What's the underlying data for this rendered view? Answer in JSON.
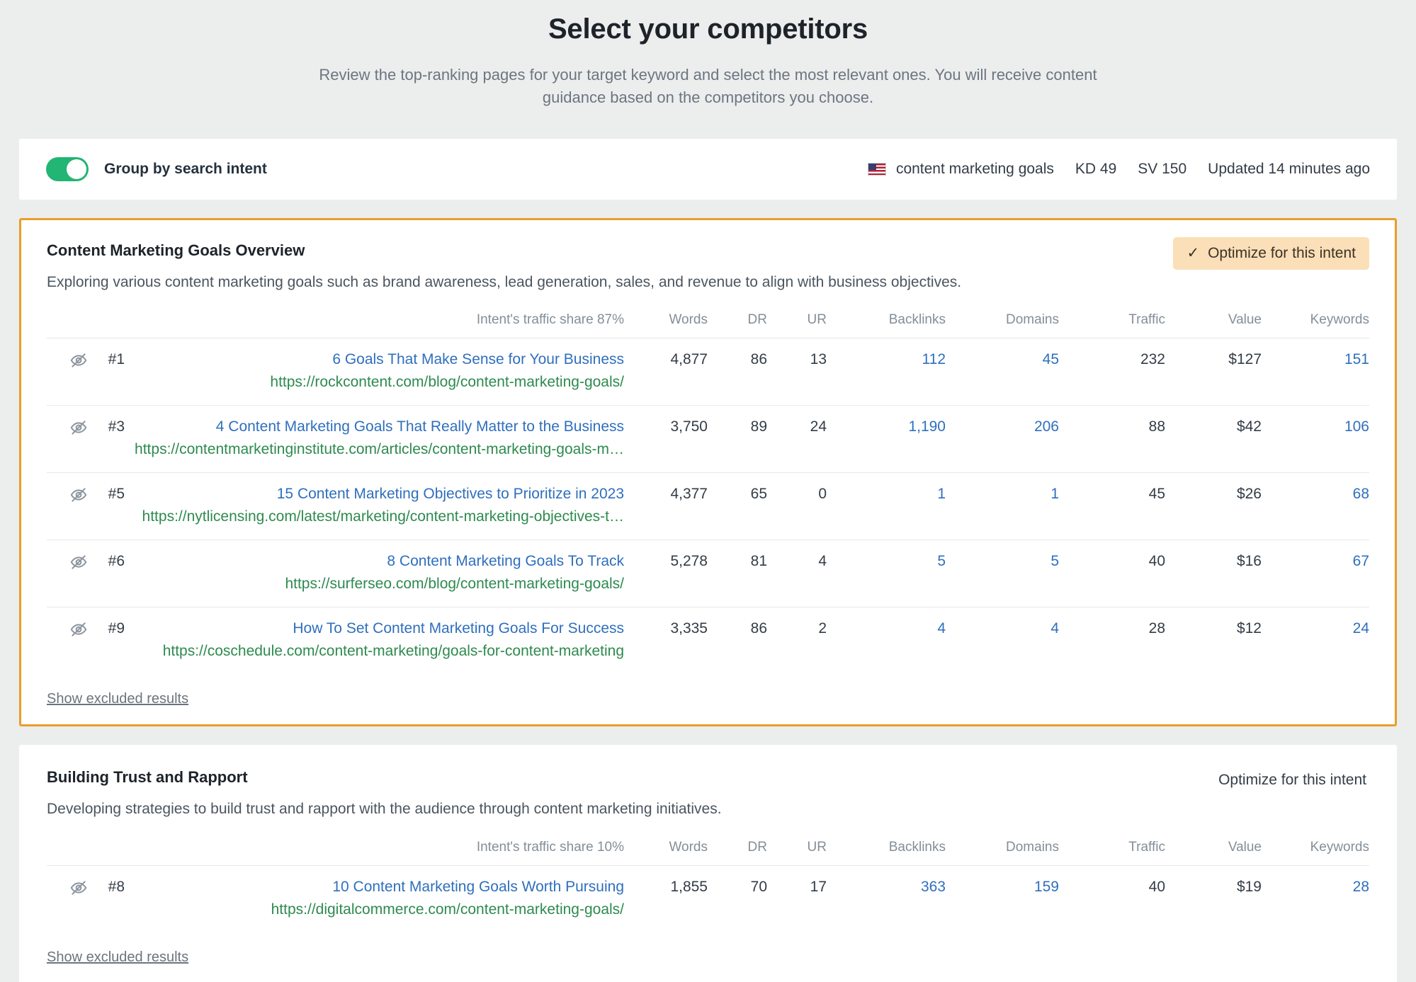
{
  "header": {
    "title": "Select your competitors",
    "subtitle": "Review the top-ranking pages for your target keyword and select the most relevant ones. You will receive content guidance based on the competitors you choose."
  },
  "toolbar": {
    "toggle_label": "Group by search intent",
    "toggle_on": true,
    "keyword": "content marketing goals",
    "kd": "KD 49",
    "sv": "SV 150",
    "updated": "Updated 14 minutes ago",
    "flag_icon": "us-flag-icon"
  },
  "columns": {
    "words": "Words",
    "dr": "DR",
    "ur": "UR",
    "backlinks": "Backlinks",
    "domains": "Domains",
    "traffic": "Traffic",
    "value": "Value",
    "keywords": "Keywords"
  },
  "common": {
    "optimize_label": "Optimize for this intent",
    "show_excluded": "Show excluded results",
    "check_icon": "check-icon",
    "eye_off_icon": "eye-off-icon"
  },
  "intents": [
    {
      "title": "Content Marketing Goals Overview",
      "description": "Exploring various content marketing goals such as brand awareness, lead generation, sales, and revenue to align with business objectives.",
      "traffic_share": "Intent's traffic share 87%",
      "selected": true,
      "optimize_label": "Optimize for this intent",
      "show_excluded": "Show excluded results",
      "rows": [
        {
          "rank": "#1",
          "title": "6 Goals That Make Sense for Your Business",
          "url": "https://rockcontent.com/blog/content-marketing-goals/",
          "words": "4,877",
          "dr": "86",
          "ur": "13",
          "backlinks": "112",
          "domains": "45",
          "traffic": "232",
          "value": "$127",
          "keywords": "151"
        },
        {
          "rank": "#3",
          "title": "4 Content Marketing Goals That Really Matter to the Business",
          "url": "https://contentmarketinginstitute.com/articles/content-marketing-goals-m…",
          "words": "3,750",
          "dr": "89",
          "ur": "24",
          "backlinks": "1,190",
          "domains": "206",
          "traffic": "88",
          "value": "$42",
          "keywords": "106"
        },
        {
          "rank": "#5",
          "title": "15 Content Marketing Objectives to Prioritize in 2023",
          "url": "https://nytlicensing.com/latest/marketing/content-marketing-objectives-t…",
          "words": "4,377",
          "dr": "65",
          "ur": "0",
          "backlinks": "1",
          "domains": "1",
          "traffic": "45",
          "value": "$26",
          "keywords": "68"
        },
        {
          "rank": "#6",
          "title": "8 Content Marketing Goals To Track",
          "url": "https://surferseo.com/blog/content-marketing-goals/",
          "words": "5,278",
          "dr": "81",
          "ur": "4",
          "backlinks": "5",
          "domains": "5",
          "traffic": "40",
          "value": "$16",
          "keywords": "67"
        },
        {
          "rank": "#9",
          "title": "How To Set Content Marketing Goals For Success",
          "url": "https://coschedule.com/content-marketing/goals-for-content-marketing",
          "words": "3,335",
          "dr": "86",
          "ur": "2",
          "backlinks": "4",
          "domains": "4",
          "traffic": "28",
          "value": "$12",
          "keywords": "24"
        }
      ]
    },
    {
      "title": "Building Trust and Rapport",
      "description": "Developing strategies to build trust and rapport with the audience through content marketing initiatives.",
      "traffic_share": "Intent's traffic share 10%",
      "selected": false,
      "optimize_label": "Optimize for this intent",
      "show_excluded": "Show excluded results",
      "rows": [
        {
          "rank": "#8",
          "title": "10 Content Marketing Goals Worth Pursuing",
          "url": "https://digitalcommerce.com/content-marketing-goals/",
          "words": "1,855",
          "dr": "70",
          "ur": "17",
          "backlinks": "363",
          "domains": "159",
          "traffic": "40",
          "value": "$19",
          "keywords": "28"
        }
      ]
    }
  ],
  "colors": {
    "accent_orange": "#e99d2b",
    "accent_orange_bg": "#fadfb8",
    "toggle_green": "#22b573",
    "link_blue": "#2f6fbd",
    "url_green": "#2e8a4f",
    "page_bg": "#eceded"
  }
}
